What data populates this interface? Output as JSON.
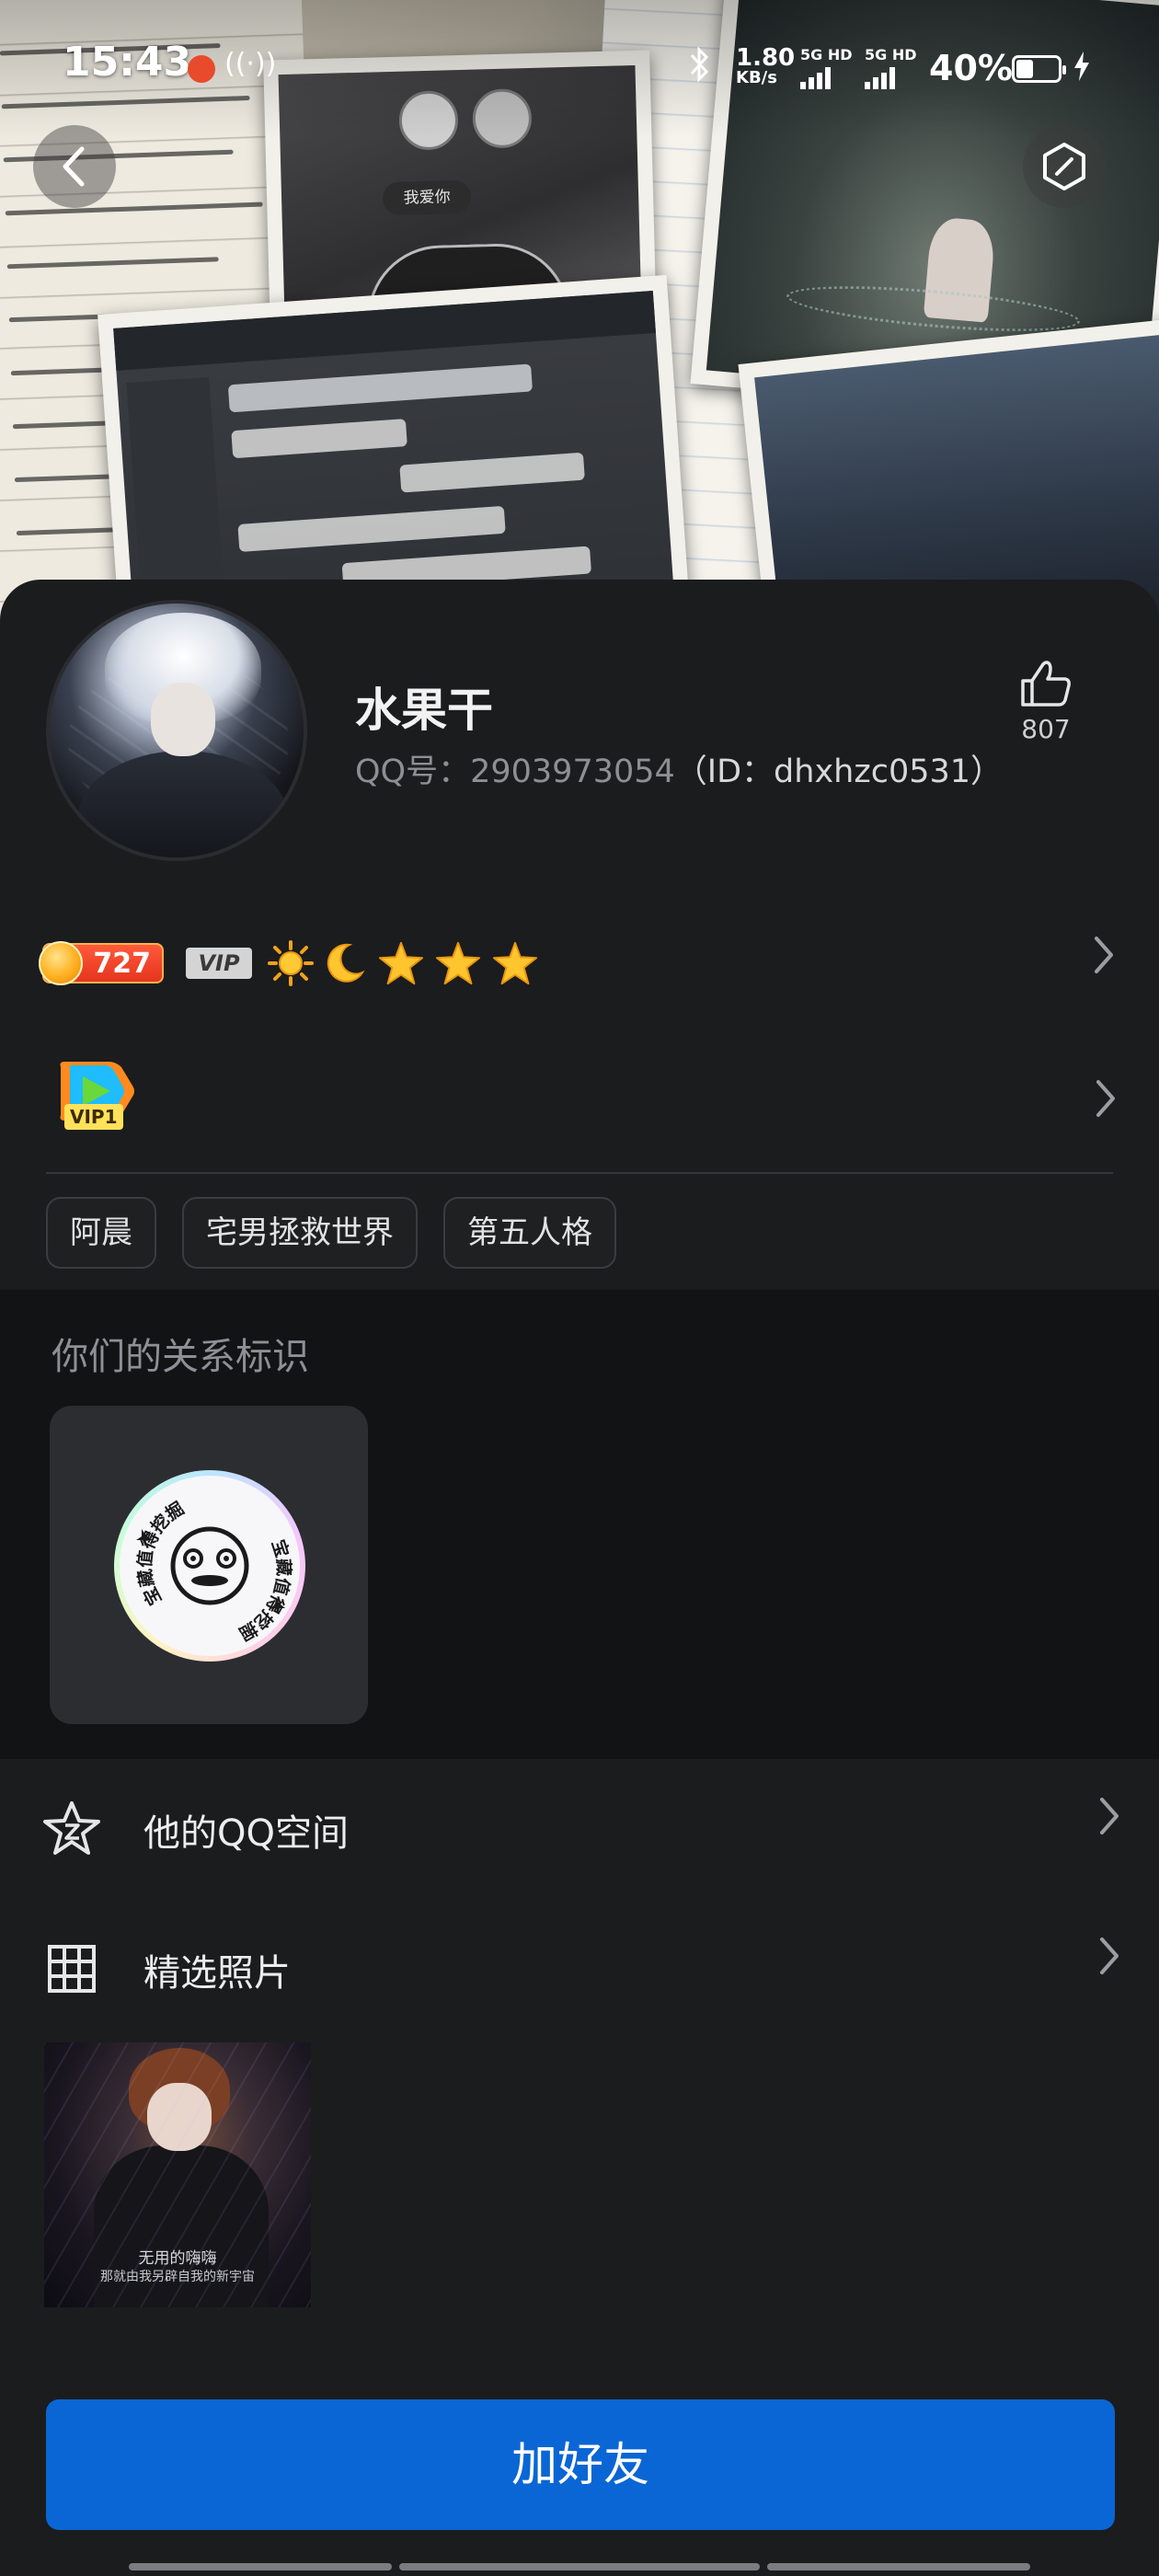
{
  "status_bar": {
    "time": "15:43",
    "net_speed_value": "1.80",
    "net_speed_unit": "KB/s",
    "sim1_label": "5G HD",
    "sim2_label": "5G HD",
    "battery_percent": "40%",
    "battery_level": 0.4,
    "icons": [
      "record-icon",
      "hotspot-icon",
      "bluetooth-icon",
      "signal-icon",
      "battery-icon",
      "charging-icon"
    ]
  },
  "cover": {
    "photo_text": "我爱你"
  },
  "profile": {
    "nickname": "水果干",
    "qq_number": "QQ号：2903973054",
    "id_text": "（ID：dhxhzc0531）",
    "likes": "807"
  },
  "level": {
    "coin_count": "727",
    "vip_label": "VIP",
    "icons": [
      "sun-icon",
      "moon-icon",
      "star-icon",
      "star-icon",
      "star-icon"
    ]
  },
  "video_vip": {
    "label": "VIP1"
  },
  "tags": [
    "阿晨",
    "宅男拯救世界",
    "第五人格"
  ],
  "relation": {
    "title": "你们的关系标识",
    "badge_text": "宝藏值得挖掘"
  },
  "menu": {
    "qzone_label": "他的QQ空间",
    "photos_label": "精选照片"
  },
  "photo_caption": {
    "line1": "无用的嗨嗨",
    "line2": "那就由我另辟自我的新宇宙"
  },
  "actions": {
    "add_friend": "加好友"
  },
  "colors": {
    "background": "#1b1c1e",
    "relation_background": "#121315",
    "primary_button": "#0a66d4",
    "muted_text": "#8c8f94"
  }
}
